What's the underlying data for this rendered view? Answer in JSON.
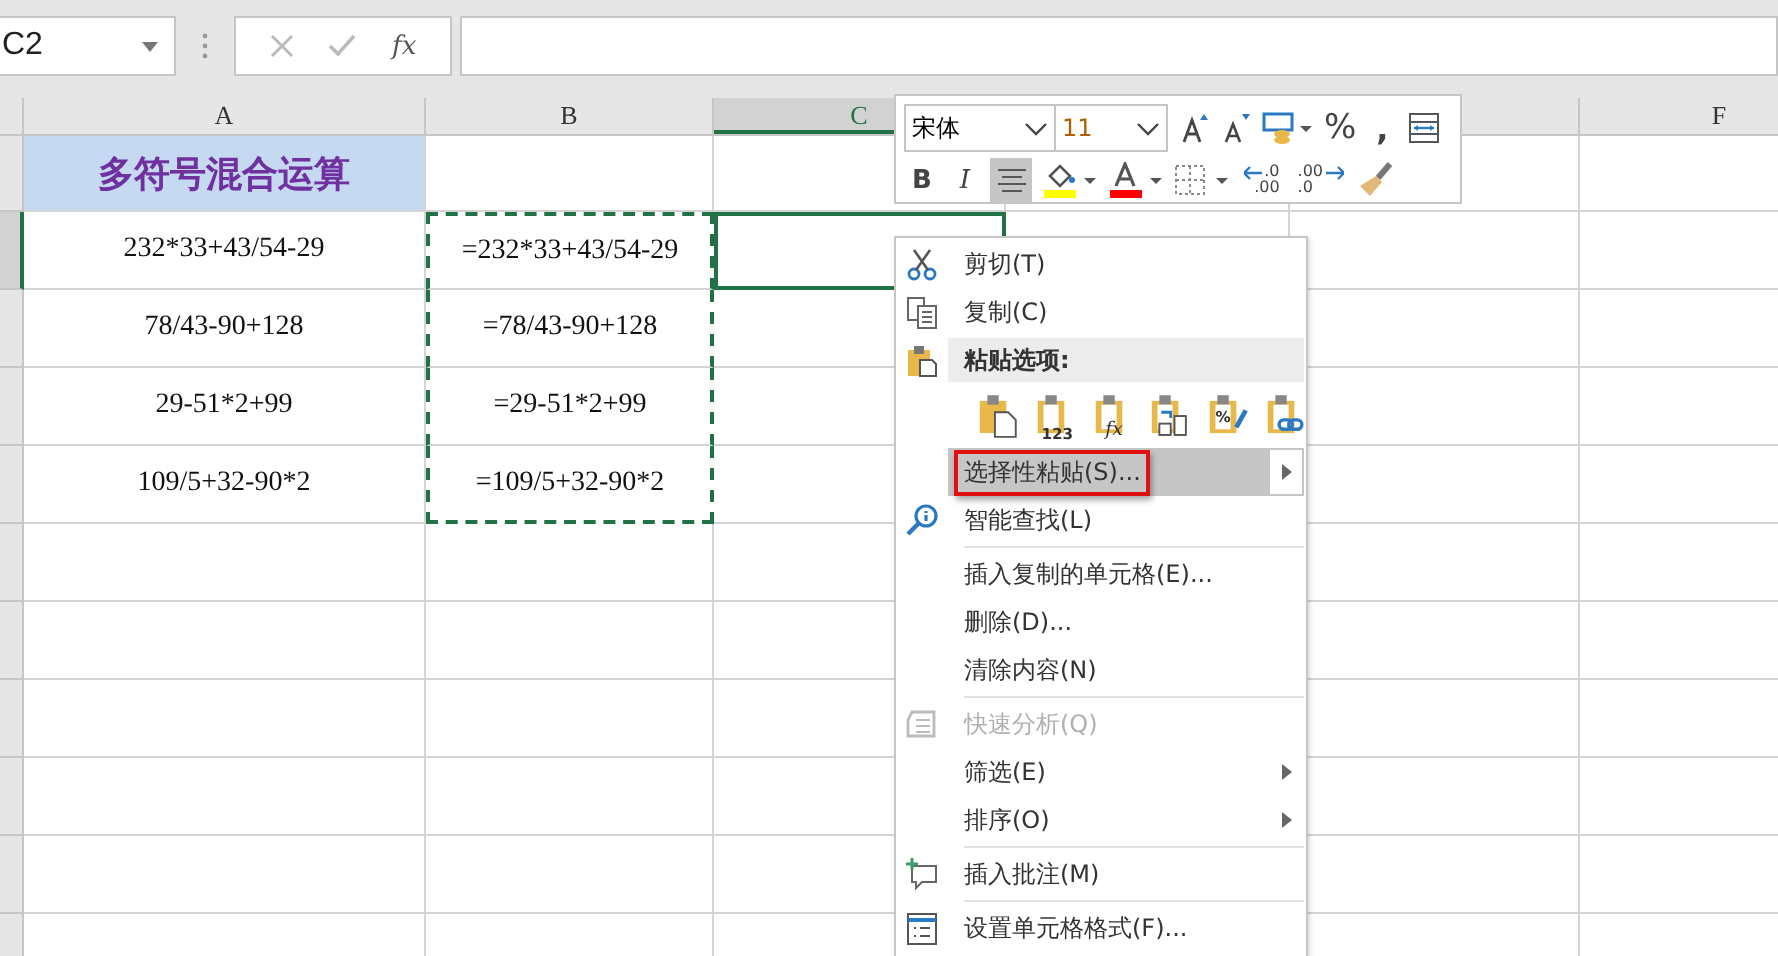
{
  "name_box": {
    "value": "C2"
  },
  "formula_bar": {
    "function_label": "fx"
  },
  "columns": [
    {
      "label": "A",
      "selected": false
    },
    {
      "label": "B",
      "selected": false
    },
    {
      "label": "C",
      "selected": true
    },
    {
      "label": "F",
      "selected": false
    }
  ],
  "title_cell": "多符号混合运算",
  "rows": [
    {
      "a": "232*33+43/54-29",
      "b": "=232*33+43/54-29",
      "selected": true,
      "copied": true
    },
    {
      "a": "78/43-90+128",
      "b": "=78/43-90+128",
      "selected": false,
      "copied": true
    },
    {
      "a": "29-51*2+99",
      "b": "=29-51*2+99",
      "selected": false,
      "copied": true
    },
    {
      "a": "109/5+32-90*2",
      "b": "=109/5+32-90*2",
      "selected": false,
      "copied": true
    },
    {
      "selected": false
    },
    {
      "selected": false
    },
    {
      "selected": false
    },
    {
      "selected": false
    },
    {
      "selected": false
    },
    {
      "selected": false
    }
  ],
  "mini_toolbar": {
    "font": "宋体",
    "size": "11",
    "bold_label": "B",
    "italic_label": "I",
    "percent_label": "%",
    "comma_label": ",",
    "decrease_decimal": [
      ".0",
      ".00"
    ],
    "increase_decimal": [
      ".00",
      ".0"
    ],
    "center_selected": true
  },
  "context_menu": [
    {
      "kind": "item",
      "label": "剪切(T)",
      "selected": false,
      "disabled": false,
      "submenu": false
    },
    {
      "kind": "item",
      "label": "复制(C)",
      "selected": false,
      "disabled": false,
      "submenu": false
    },
    {
      "kind": "header",
      "label": "粘贴选项:"
    },
    {
      "kind": "paste_options",
      "value_label": "123",
      "formulas_label": "fx",
      "formatting_label": "%"
    },
    {
      "kind": "item",
      "label": "选择性粘贴(S)...",
      "selected": true,
      "disabled": false,
      "submenu": true
    },
    {
      "kind": "item",
      "label": "智能查找(L)",
      "selected": false,
      "disabled": false,
      "submenu": false
    },
    {
      "kind": "separator"
    },
    {
      "kind": "item",
      "label": "插入复制的单元格(E)...",
      "selected": false,
      "disabled": false,
      "submenu": false
    },
    {
      "kind": "item",
      "label": "删除(D)...",
      "selected": false,
      "disabled": false,
      "submenu": false
    },
    {
      "kind": "item",
      "label": "清除内容(N)",
      "selected": false,
      "disabled": false,
      "submenu": false
    },
    {
      "kind": "separator"
    },
    {
      "kind": "item",
      "label": "快速分析(Q)",
      "selected": false,
      "disabled": true,
      "submenu": false
    },
    {
      "kind": "item",
      "label": "筛选(E)",
      "selected": false,
      "disabled": false,
      "submenu": true
    },
    {
      "kind": "item",
      "label": "排序(O)",
      "selected": false,
      "disabled": false,
      "submenu": true
    },
    {
      "kind": "separator"
    },
    {
      "kind": "item",
      "label": "插入批注(M)",
      "selected": false,
      "disabled": false,
      "submenu": false
    },
    {
      "kind": "separator"
    },
    {
      "kind": "item",
      "label": "设置单元格格式(F)...",
      "selected": false,
      "disabled": false,
      "submenu": false
    }
  ]
}
